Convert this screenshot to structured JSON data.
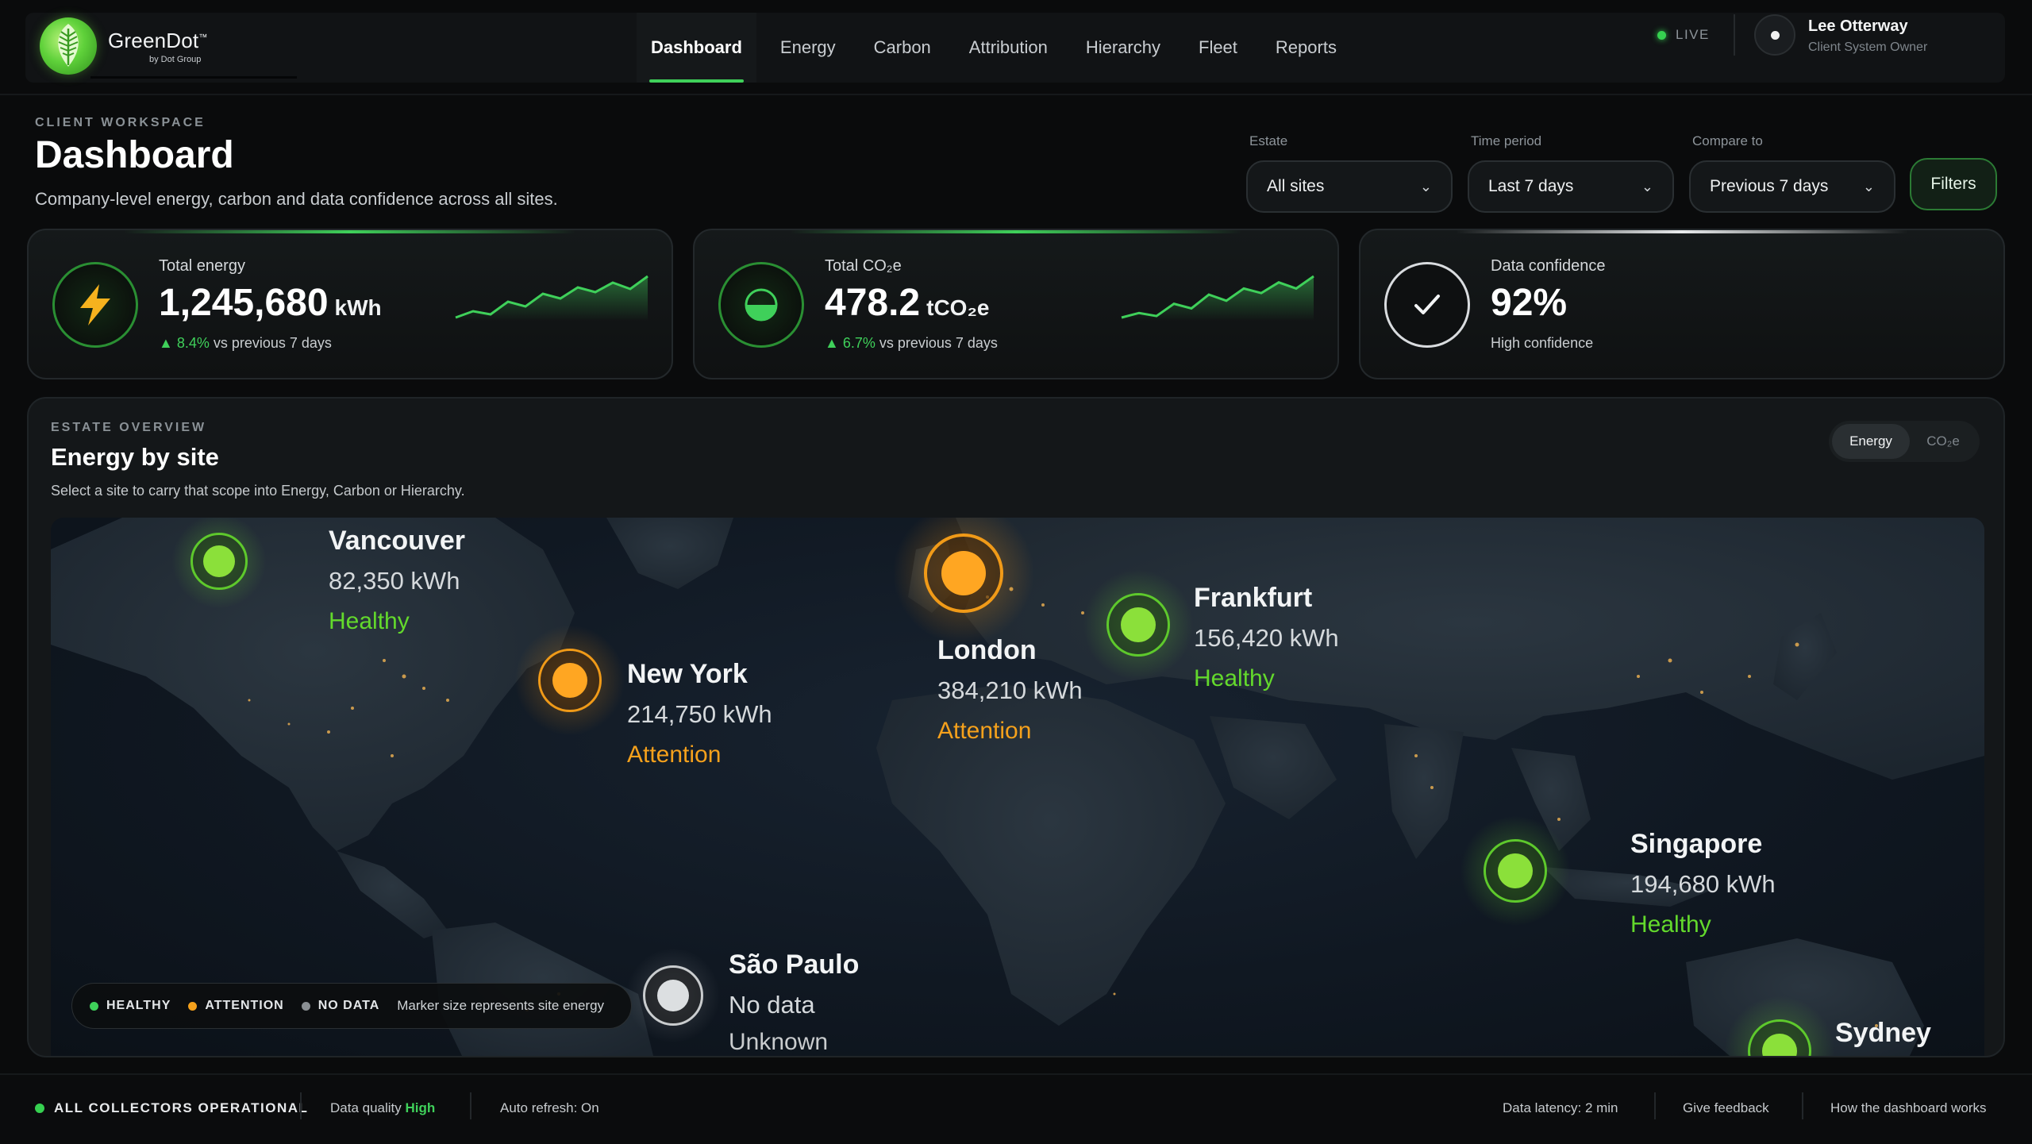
{
  "brand": {
    "name": "GreenDot",
    "tm": "™",
    "sub": "by Dot Group"
  },
  "nav": {
    "tabs": [
      "Dashboard",
      "Energy",
      "Carbon",
      "Attribution",
      "Hierarchy",
      "Fleet",
      "Reports"
    ],
    "active": "Dashboard"
  },
  "status": {
    "live": "LIVE"
  },
  "user": {
    "name": "Lee Otterway",
    "role": "Client System Owner"
  },
  "header": {
    "eyebrow": "CLIENT WORKSPACE",
    "title": "Dashboard",
    "subtitle": "Company-level energy, carbon and data confidence across all sites."
  },
  "filters": {
    "estate": {
      "label": "Estate",
      "value": "All sites"
    },
    "period": {
      "label": "Time period",
      "value": "Last 7 days"
    },
    "compare": {
      "label": "Compare to",
      "value": "Previous 7 days"
    },
    "button": "Filters"
  },
  "kpis": {
    "energy": {
      "label": "Total energy",
      "value": "1,245,680",
      "unit": "kWh",
      "delta": "▲ 8.4%",
      "delta_suffix": " vs previous 7 days",
      "trend": [
        12,
        16,
        14,
        22,
        19,
        27,
        24,
        31,
        28,
        34,
        30,
        38
      ]
    },
    "carbon": {
      "label": "Total CO₂e",
      "value": "478.2",
      "unit": "tCO₂e",
      "delta": "▲ 6.7%",
      "delta_suffix": " vs previous 7 days",
      "trend": [
        10,
        13,
        11,
        19,
        16,
        25,
        21,
        29,
        26,
        33,
        29,
        37
      ]
    },
    "confidence": {
      "label": "Data confidence",
      "value": "92%",
      "foot": "High confidence"
    }
  },
  "estate": {
    "eyebrow": "ESTATE OVERVIEW",
    "title": "Energy by site",
    "subtitle": "Select a site to carry that scope into Energy, Carbon or Hierarchy.",
    "toggle": [
      "Energy",
      "CO₂e"
    ],
    "toggle_active": "Energy",
    "sites": [
      {
        "name": "Vancouver",
        "value": "82,350 kWh",
        "status": "Healthy",
        "state": "healthy"
      },
      {
        "name": "New York",
        "value": "214,750 kWh",
        "status": "Attention",
        "state": "attention"
      },
      {
        "name": "London",
        "value": "384,210 kWh",
        "status": "Attention",
        "state": "attention"
      },
      {
        "name": "Frankfurt",
        "value": "156,420 kWh",
        "status": "Healthy",
        "state": "healthy"
      },
      {
        "name": "Singapore",
        "value": "194,680 kWh",
        "status": "Healthy",
        "state": "healthy"
      },
      {
        "name": "São Paulo",
        "value": "No data",
        "status": "Unknown",
        "state": "nodata"
      },
      {
        "name": "Sydney",
        "value": "",
        "status": "",
        "state": "healthy"
      }
    ],
    "legend": {
      "healthy": "HEALTHY",
      "attention": "ATTENTION",
      "nodata": "NO DATA",
      "note": "Marker size represents site energy"
    }
  },
  "footer": {
    "collectors": "ALL COLLECTORS OPERATIONAL",
    "quality_label": "Data quality ",
    "quality_value": "High",
    "refresh": "Auto refresh: On",
    "latency": "Data latency: 2 min",
    "feedback": "Give feedback",
    "howto": "How the dashboard works"
  },
  "colors": {
    "accent": "#3fd05a",
    "healthy": "#7ddc2e",
    "attention": "#f5a11c",
    "nodata": "#d9dcde",
    "background": "#0a0b0c"
  }
}
